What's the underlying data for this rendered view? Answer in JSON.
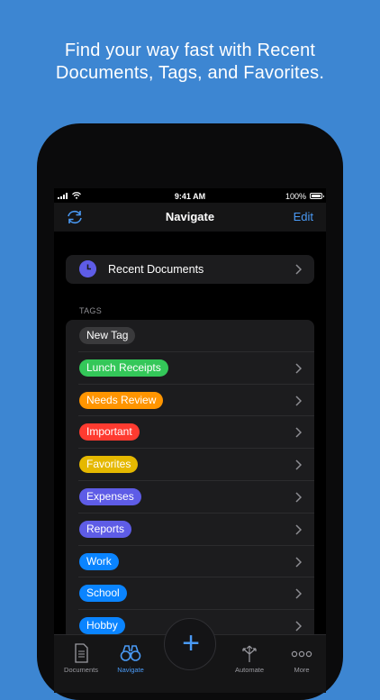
{
  "promo": {
    "line1": "Find your way fast with Recent",
    "line2": "Documents, Tags, and Favorites."
  },
  "status": {
    "time": "9:41 AM",
    "battery": "100%"
  },
  "navbar": {
    "title": "Navigate",
    "edit_label": "Edit",
    "left_icon": "sync-icon"
  },
  "recent": {
    "label": "Recent Documents",
    "icon": "clock-icon",
    "icon_color": "#5e5ce6"
  },
  "tags": {
    "header": "TAGS",
    "items": [
      {
        "label": "New Tag",
        "color": "#3a3a3c",
        "chevron": false
      },
      {
        "label": "Lunch Receipts",
        "color": "#34c759",
        "chevron": true
      },
      {
        "label": "Needs Review",
        "color": "#ff9500",
        "chevron": true
      },
      {
        "label": "Important",
        "color": "#ff3b30",
        "chevron": true
      },
      {
        "label": "Favorites",
        "color": "#e5b800",
        "chevron": true
      },
      {
        "label": "Expenses",
        "color": "#5e5ce6",
        "chevron": true
      },
      {
        "label": "Reports",
        "color": "#5e5ce6",
        "chevron": true
      },
      {
        "label": "Work",
        "color": "#0a84ff",
        "chevron": true
      },
      {
        "label": "School",
        "color": "#0a84ff",
        "chevron": true
      },
      {
        "label": "Hobby",
        "color": "#0a84ff",
        "chevron": true
      }
    ]
  },
  "tabbar": {
    "documents": "Documents",
    "navigate": "Navigate",
    "add": "+",
    "automate": "Automate",
    "more": "More"
  },
  "colors": {
    "background": "#3d86d2",
    "accent": "#4a9af5"
  }
}
